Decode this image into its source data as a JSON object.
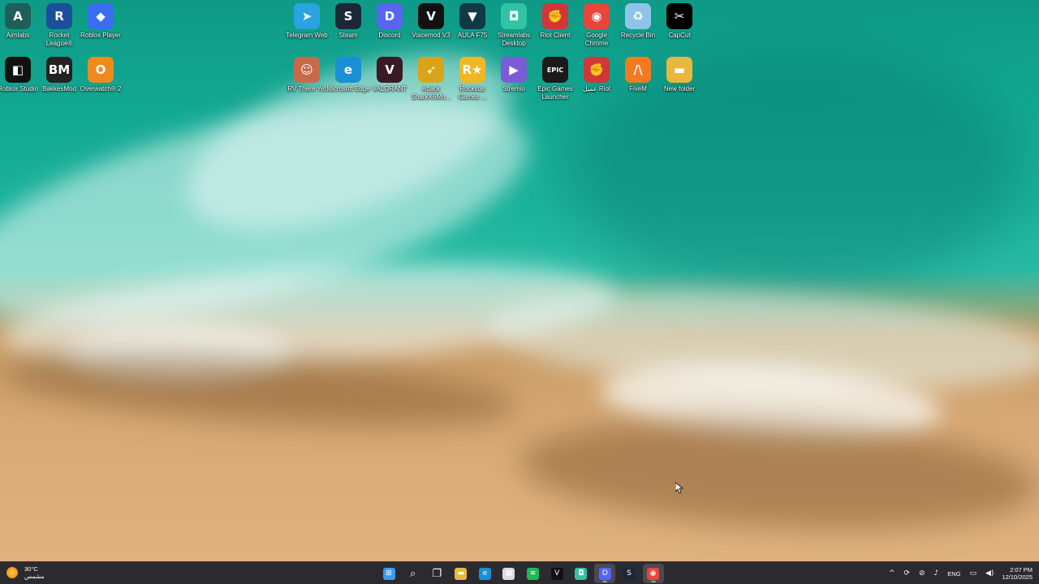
{
  "desktop": {
    "icons": [
      {
        "label": "Aimlabs",
        "icon": "aimlabs-icon",
        "glyph": "A",
        "color": "#1f5f5a"
      },
      {
        "label": "Rocket League®",
        "icon": "rocket-league-icon",
        "glyph": "R",
        "color": "#1b4f9a"
      },
      {
        "label": "Roblox Player",
        "icon": "roblox-player-icon",
        "glyph": "◆",
        "color": "#3a6df0"
      },
      {
        "label": "Telegram Web",
        "icon": "telegram-icon",
        "glyph": "➤",
        "color": "#2aa3e0"
      },
      {
        "label": "Steam",
        "icon": "steam-icon",
        "glyph": "S",
        "color": "#1b2838"
      },
      {
        "label": "Discord",
        "icon": "discord-icon",
        "glyph": "D",
        "color": "#5865f2"
      },
      {
        "label": "Voicemod V3",
        "icon": "voicemod-icon",
        "glyph": "V",
        "color": "#111111"
      },
      {
        "label": "AULA F75",
        "icon": "aula-icon",
        "glyph": "▼",
        "color": "#0f3a45"
      },
      {
        "label": "Streamlabs Desktop",
        "icon": "streamlabs-icon",
        "glyph": "◘",
        "color": "#31c3a2"
      },
      {
        "label": "Riot Client",
        "icon": "riot-client-icon",
        "glyph": "✊",
        "color": "#d13639"
      },
      {
        "label": "Google Chrome",
        "icon": "chrome-icon",
        "glyph": "◉",
        "color": "#e8453c"
      },
      {
        "label": "Recycle Bin",
        "icon": "recycle-bin-icon",
        "glyph": "♻",
        "color": "#8fc4e8"
      },
      {
        "label": "CapCut",
        "icon": "capcut-icon",
        "glyph": "✂",
        "color": "#000000"
      },
      {
        "label": "Roblox Studio",
        "icon": "roblox-studio-icon",
        "glyph": "◧",
        "color": "#111111"
      },
      {
        "label": "BakkesMod",
        "icon": "bakkesmod-icon",
        "glyph": "BM",
        "color": "#222222"
      },
      {
        "label": "Overwatch® 2",
        "icon": "overwatch-icon",
        "glyph": "O",
        "color": "#f08a1c"
      },
      {
        "label": "RV There Yet",
        "icon": "rv-there-yet-icon",
        "glyph": "☺",
        "color": "#c86a4a"
      },
      {
        "label": "Microsoft Edge",
        "icon": "edge-icon",
        "glyph": "e",
        "color": "#1b8fd4"
      },
      {
        "label": "VALORANT",
        "icon": "valorant-icon",
        "glyph": "V",
        "color": "#3a1a24"
      },
      {
        "label": "Attack SharkX6Mo...",
        "icon": "attack-shark-icon",
        "glyph": "➶",
        "color": "#d9a418"
      },
      {
        "label": "Rockstar Games ...",
        "icon": "rockstar-icon",
        "glyph": "R★",
        "color": "#f2b623"
      },
      {
        "label": "Stremio",
        "icon": "stremio-icon",
        "glyph": "▶",
        "color": "#7b5bd6"
      },
      {
        "label": "Epic Games Launcher",
        "icon": "epic-games-icon",
        "glyph": "EPIC",
        "color": "#1a1a1a"
      },
      {
        "label": "عميل Riot",
        "icon": "riot-client-ar-icon",
        "glyph": "✊",
        "color": "#d13639"
      },
      {
        "label": "FiveM",
        "icon": "fivem-icon",
        "glyph": "/\\",
        "color": "#f47a20"
      },
      {
        "label": "New folder",
        "icon": "folder-icon",
        "glyph": "▬",
        "color": "#e9b83a"
      }
    ]
  },
  "taskbar": {
    "weather": {
      "temp": "30°C",
      "condition": "مشمس",
      "icon": "sun-icon"
    },
    "buttons": [
      {
        "name": "start-button",
        "glyph": "⊞",
        "color": "#3b9cf0",
        "active": false
      },
      {
        "name": "search-button",
        "glyph": "⌕",
        "color": "transparent",
        "active": false
      },
      {
        "name": "task-view-button",
        "glyph": "❐",
        "color": "transparent",
        "active": false
      },
      {
        "name": "file-explorer-button",
        "glyph": "▬",
        "color": "#e9b83a",
        "active": false
      },
      {
        "name": "edge-taskbar-button",
        "glyph": "e",
        "color": "#1b8fd4",
        "active": false
      },
      {
        "name": "store-button",
        "glyph": "▦",
        "color": "#dcdcdc",
        "active": false
      },
      {
        "name": "spotify-button",
        "glyph": "≋",
        "color": "#1db954",
        "active": false
      },
      {
        "name": "voicemod-taskbar-button",
        "glyph": "V",
        "color": "#111111",
        "active": false
      },
      {
        "name": "streamlabs-taskbar-button",
        "glyph": "◘",
        "color": "#31c3a2",
        "active": false
      },
      {
        "name": "discord-taskbar-button",
        "glyph": "D",
        "color": "#5865f2",
        "active": true
      },
      {
        "name": "steam-taskbar-button",
        "glyph": "S",
        "color": "#1b2838",
        "active": false
      },
      {
        "name": "chrome-taskbar-button",
        "glyph": "◉",
        "color": "#e8453c",
        "active": true
      }
    ],
    "tray": {
      "chevron": "^",
      "language": "ENG",
      "time": "2:07 PM",
      "date": "12/10/2025"
    }
  }
}
